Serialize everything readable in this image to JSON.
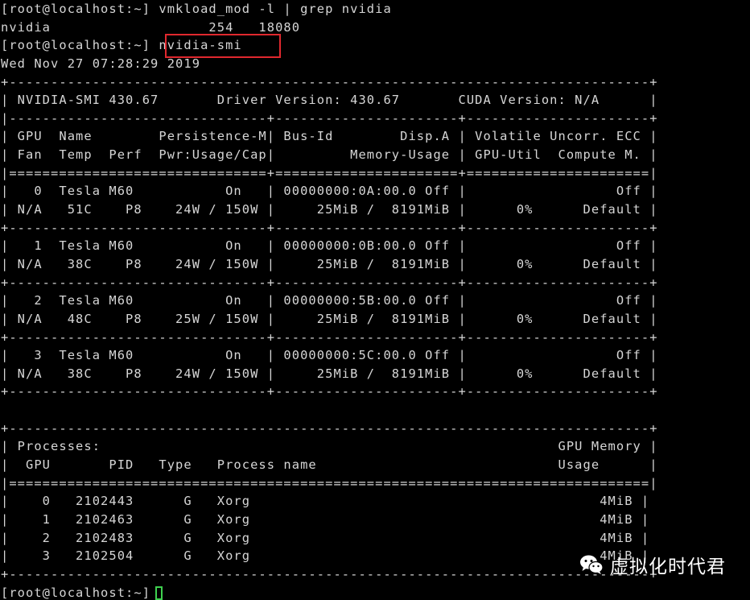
{
  "terminal": {
    "lines": [
      "[root@localhost:~] vmkload_mod -l | grep nvidia",
      "nvidia                   254   18080",
      "[root@localhost:~] nvidia-smi",
      "Wed Nov 27 07:28:29 2019",
      "+-----------------------------------------------------------------------------+",
      "| NVIDIA-SMI 430.67       Driver Version: 430.67       CUDA Version: N/A      |",
      "|-------------------------------+----------------------+----------------------+",
      "| GPU  Name        Persistence-M| Bus-Id        Disp.A | Volatile Uncorr. ECC |",
      "| Fan  Temp  Perf  Pwr:Usage/Cap|         Memory-Usage | GPU-Util  Compute M. |",
      "|===============================+======================+======================|",
      "|   0  Tesla M60           On   | 00000000:0A:00.0 Off |                  Off |",
      "| N/A   51C    P8    24W / 150W |     25MiB /  8191MiB |      0%      Default |",
      "+-------------------------------+----------------------+----------------------+",
      "|   1  Tesla M60           On   | 00000000:0B:00.0 Off |                  Off |",
      "| N/A   38C    P8    24W / 150W |     25MiB /  8191MiB |      0%      Default |",
      "+-------------------------------+----------------------+----------------------+",
      "|   2  Tesla M60           On   | 00000000:5B:00.0 Off |                  Off |",
      "| N/A   48C    P8    25W / 150W |     25MiB /  8191MiB |      0%      Default |",
      "+-------------------------------+----------------------+----------------------+",
      "|   3  Tesla M60           On   | 00000000:5C:00.0 Off |                  Off |",
      "| N/A   38C    P8    24W / 150W |     25MiB /  8191MiB |      0%      Default |",
      "+-------------------------------+----------------------+----------------------+",
      "",
      "+-----------------------------------------------------------------------------+",
      "| Processes:                                                       GPU Memory |",
      "|  GPU       PID   Type   Process name                             Usage      |",
      "|=============================================================================|",
      "|    0   2102443      G   Xorg                                          4MiB |",
      "|    1   2102463      G   Xorg                                          4MiB |",
      "|    2   2102483      G   Xorg                                          4MiB |",
      "|    3   2102504      G   Xorg                                          4MiB |",
      "+-----------------------------------------------------------------------------+"
    ],
    "prompt": "[root@localhost:~]"
  },
  "watermark": {
    "text": "虚拟化时代君",
    "icon": "wechat-logo-icon"
  },
  "colors": {
    "background": "#000000",
    "text": "#d6d6d6",
    "highlight": "#e0282e",
    "cursor": "#3fd14f"
  }
}
